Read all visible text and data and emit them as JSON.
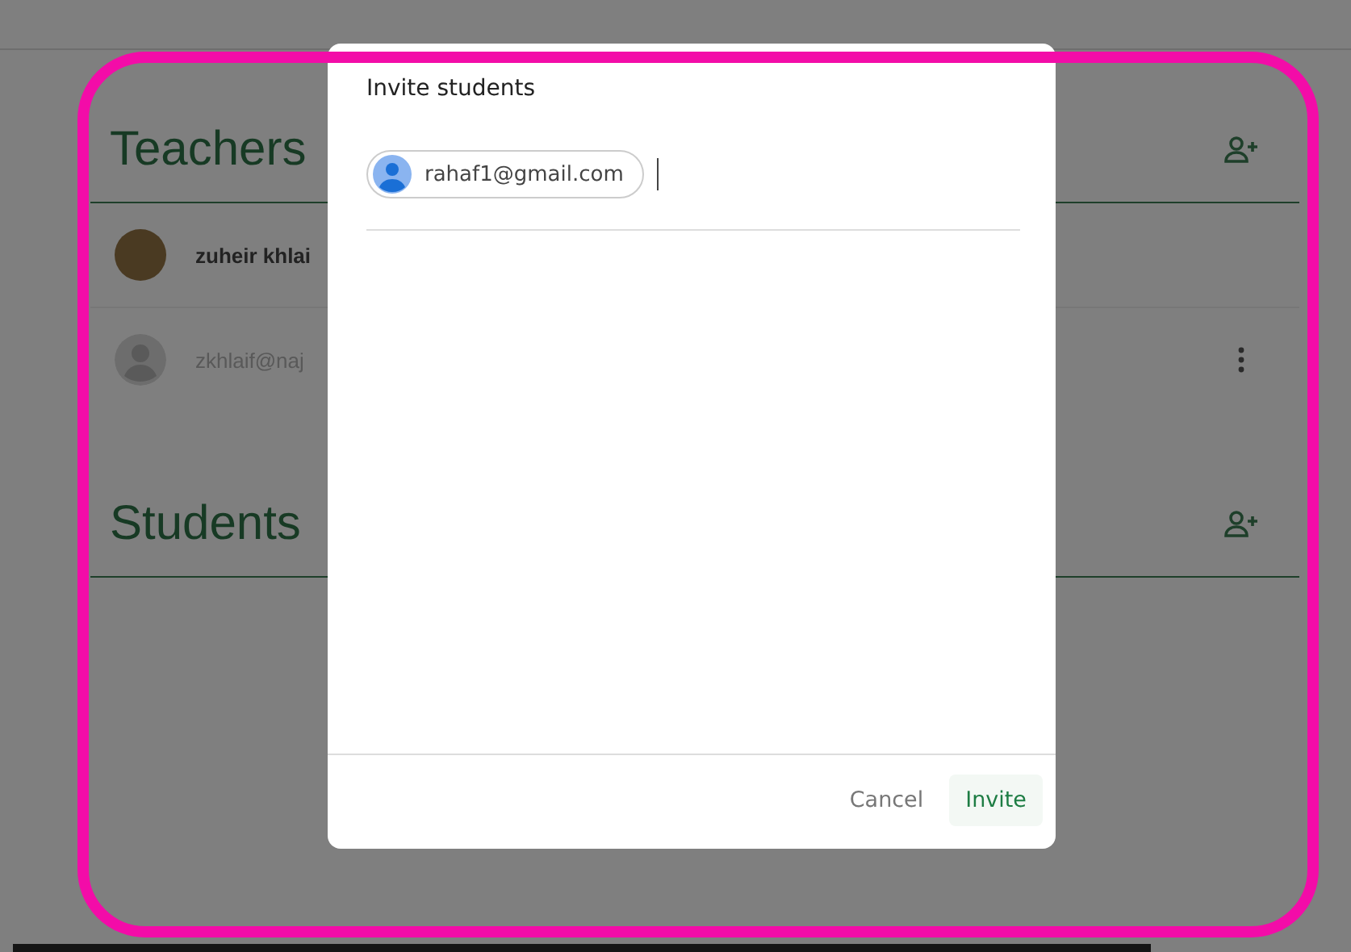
{
  "sections": [
    {
      "heading": "Teachers",
      "people": [
        {
          "name": "zuheir khlai",
          "kind": "photo",
          "pending": false,
          "menu": false
        },
        {
          "name": "zkhlaif@naj",
          "kind": "default",
          "pending": true,
          "menu": true
        }
      ]
    },
    {
      "heading": "Students"
    }
  ],
  "dialog": {
    "title": "Invite students",
    "chips": [
      {
        "email": "rahaf1@gmail.com"
      }
    ],
    "buttons": [
      {
        "label": "Cancel",
        "primary": false
      },
      {
        "label": "Invite",
        "primary": true
      }
    ]
  }
}
